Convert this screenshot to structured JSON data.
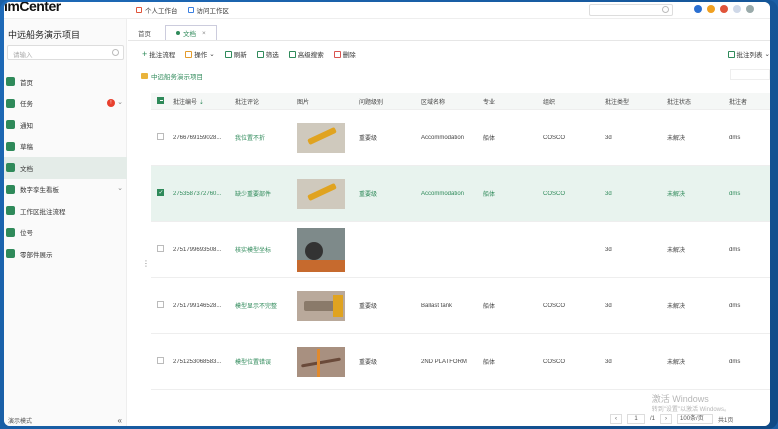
{
  "app": {
    "logo": "imCenter"
  },
  "topnav": {
    "personal": "个人工作台",
    "visit": "访问工作区"
  },
  "sidebar": {
    "project_title": "中远船务演示项目",
    "search_placeholder": "请输入",
    "items": [
      {
        "label": "首页",
        "icon": "home-icon"
      },
      {
        "label": "任务",
        "icon": "task-icon",
        "badge": "!"
      },
      {
        "label": "通知",
        "icon": "notice-icon"
      },
      {
        "label": "草稿",
        "icon": "draft-icon"
      },
      {
        "label": "文档",
        "icon": "document-icon",
        "active": true
      },
      {
        "label": "数字孪生看板",
        "icon": "dashboard-icon"
      },
      {
        "label": "工作区批注流程",
        "icon": "workflow-icon"
      },
      {
        "label": "位号",
        "icon": "tag-icon"
      },
      {
        "label": "零部件展示",
        "icon": "parts-icon"
      }
    ],
    "footer": "演示模式"
  },
  "tabs": [
    {
      "label": "首页",
      "active": false
    },
    {
      "label": "文档",
      "active": true
    }
  ],
  "toolbar": {
    "annotate_flow": "批注流程",
    "operate": "操作",
    "refresh": "刷新",
    "filter": "筛选",
    "advanced_search": "高级搜索",
    "delete": "删除",
    "column_list": "批注列表"
  },
  "breadcrumb": "中远船务演示项目",
  "table": {
    "headers": [
      "批注编号",
      "批注评论",
      "图片",
      "问题级别",
      "区域名称",
      "专业",
      "组织",
      "批注类型",
      "批注状态",
      "批注者"
    ],
    "rows": [
      {
        "no": "2766769159028...",
        "comment": "我位置不折",
        "level": "重要级",
        "area": "Accommodation",
        "major": "船体",
        "org": "COSCO",
        "type": "3d",
        "status": "未解决",
        "user": "dms",
        "img": "crane",
        "selected": false
      },
      {
        "no": "2753587372760...",
        "comment": "缺少重要部件",
        "level": "重要级",
        "area": "Accommodation",
        "major": "船体",
        "org": "COSCO",
        "type": "3d",
        "status": "未解决",
        "user": "dms",
        "img": "crane",
        "selected": true
      },
      {
        "no": "2751799693508...",
        "comment": "核实模型坐标",
        "level": "",
        "area": "",
        "major": "",
        "org": "",
        "type": "3d",
        "status": "未解决",
        "user": "dms",
        "img": "tall",
        "selected": false
      },
      {
        "no": "2751799146528...",
        "comment": "模型显示不完整",
        "level": "重要级",
        "area": "Ballast tank",
        "major": "船体",
        "org": "COSCO",
        "type": "3d",
        "status": "未解决",
        "user": "dms",
        "img": "beam",
        "selected": false
      },
      {
        "no": "2751253068583...",
        "comment": "模型位置错误",
        "level": "重要级",
        "area": "2ND PLATFORM",
        "major": "船体",
        "org": "COSCO",
        "type": "3d",
        "status": "未解决",
        "user": "dms",
        "img": "plat",
        "selected": false
      }
    ]
  },
  "pager": {
    "current": "1",
    "total": "/1",
    "page_size": "100条/页",
    "summary": "共1页"
  },
  "watermark": {
    "line1": "激活 Windows",
    "line2": "转到\"设置\"以激活 Windows。"
  }
}
